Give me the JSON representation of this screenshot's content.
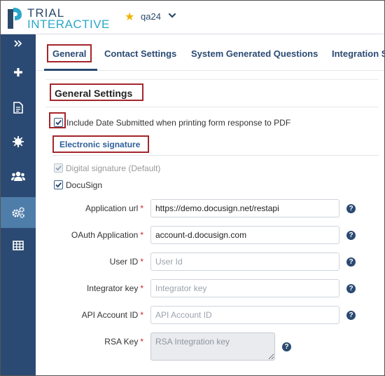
{
  "app": {
    "logo_line1": "TRIAL",
    "logo_line2": "INTERACTIVE",
    "project_name": "qa24"
  },
  "sidebar": {
    "items": [
      {
        "icon": "collapse-double-chevron-icon"
      },
      {
        "icon": "plus-icon"
      },
      {
        "icon": "document-icon"
      },
      {
        "icon": "burst-icon"
      },
      {
        "icon": "users-icon"
      },
      {
        "icon": "cogs-icon",
        "active": true
      },
      {
        "icon": "table-icon"
      }
    ]
  },
  "tabs": [
    {
      "label": "General",
      "active": true
    },
    {
      "label": "Contact Settings"
    },
    {
      "label": "System Generated Questions"
    },
    {
      "label": "Integration Settings"
    }
  ],
  "general_settings": {
    "title": "General Settings",
    "include_date_label": "Include Date Submitted when printing form response to PDF",
    "include_date_checked": true
  },
  "electronic_signature": {
    "title": "Electronic signature",
    "digital_signature_label": "Digital signature (Default)",
    "digital_signature_checked": true,
    "docusign_label": "DocuSign",
    "docusign_checked": true
  },
  "fields": {
    "application_url": {
      "label": "Application url",
      "value": "https://demo.docusign.net/restapi",
      "placeholder": ""
    },
    "oauth_application": {
      "label": "OAuth Application",
      "value": "account-d.docusign.com",
      "placeholder": ""
    },
    "user_id": {
      "label": "User ID",
      "value": "",
      "placeholder": "User Id"
    },
    "integrator_key": {
      "label": "Integrator key",
      "value": "",
      "placeholder": "Integrator key"
    },
    "api_account_id": {
      "label": "API Account ID",
      "value": "",
      "placeholder": "API Account ID"
    },
    "rsa_key": {
      "label": "RSA Key",
      "value": "",
      "placeholder": "RSA Integration key"
    },
    "required_mark": "*",
    "help_glyph": "?"
  },
  "colors": {
    "sidebar": "#2b4a73",
    "sidebar_active": "#4f7daa",
    "accent": "#2b4a73",
    "annotation_red": "#a5262b",
    "required": "#d0202a",
    "star": "#f0b400"
  }
}
